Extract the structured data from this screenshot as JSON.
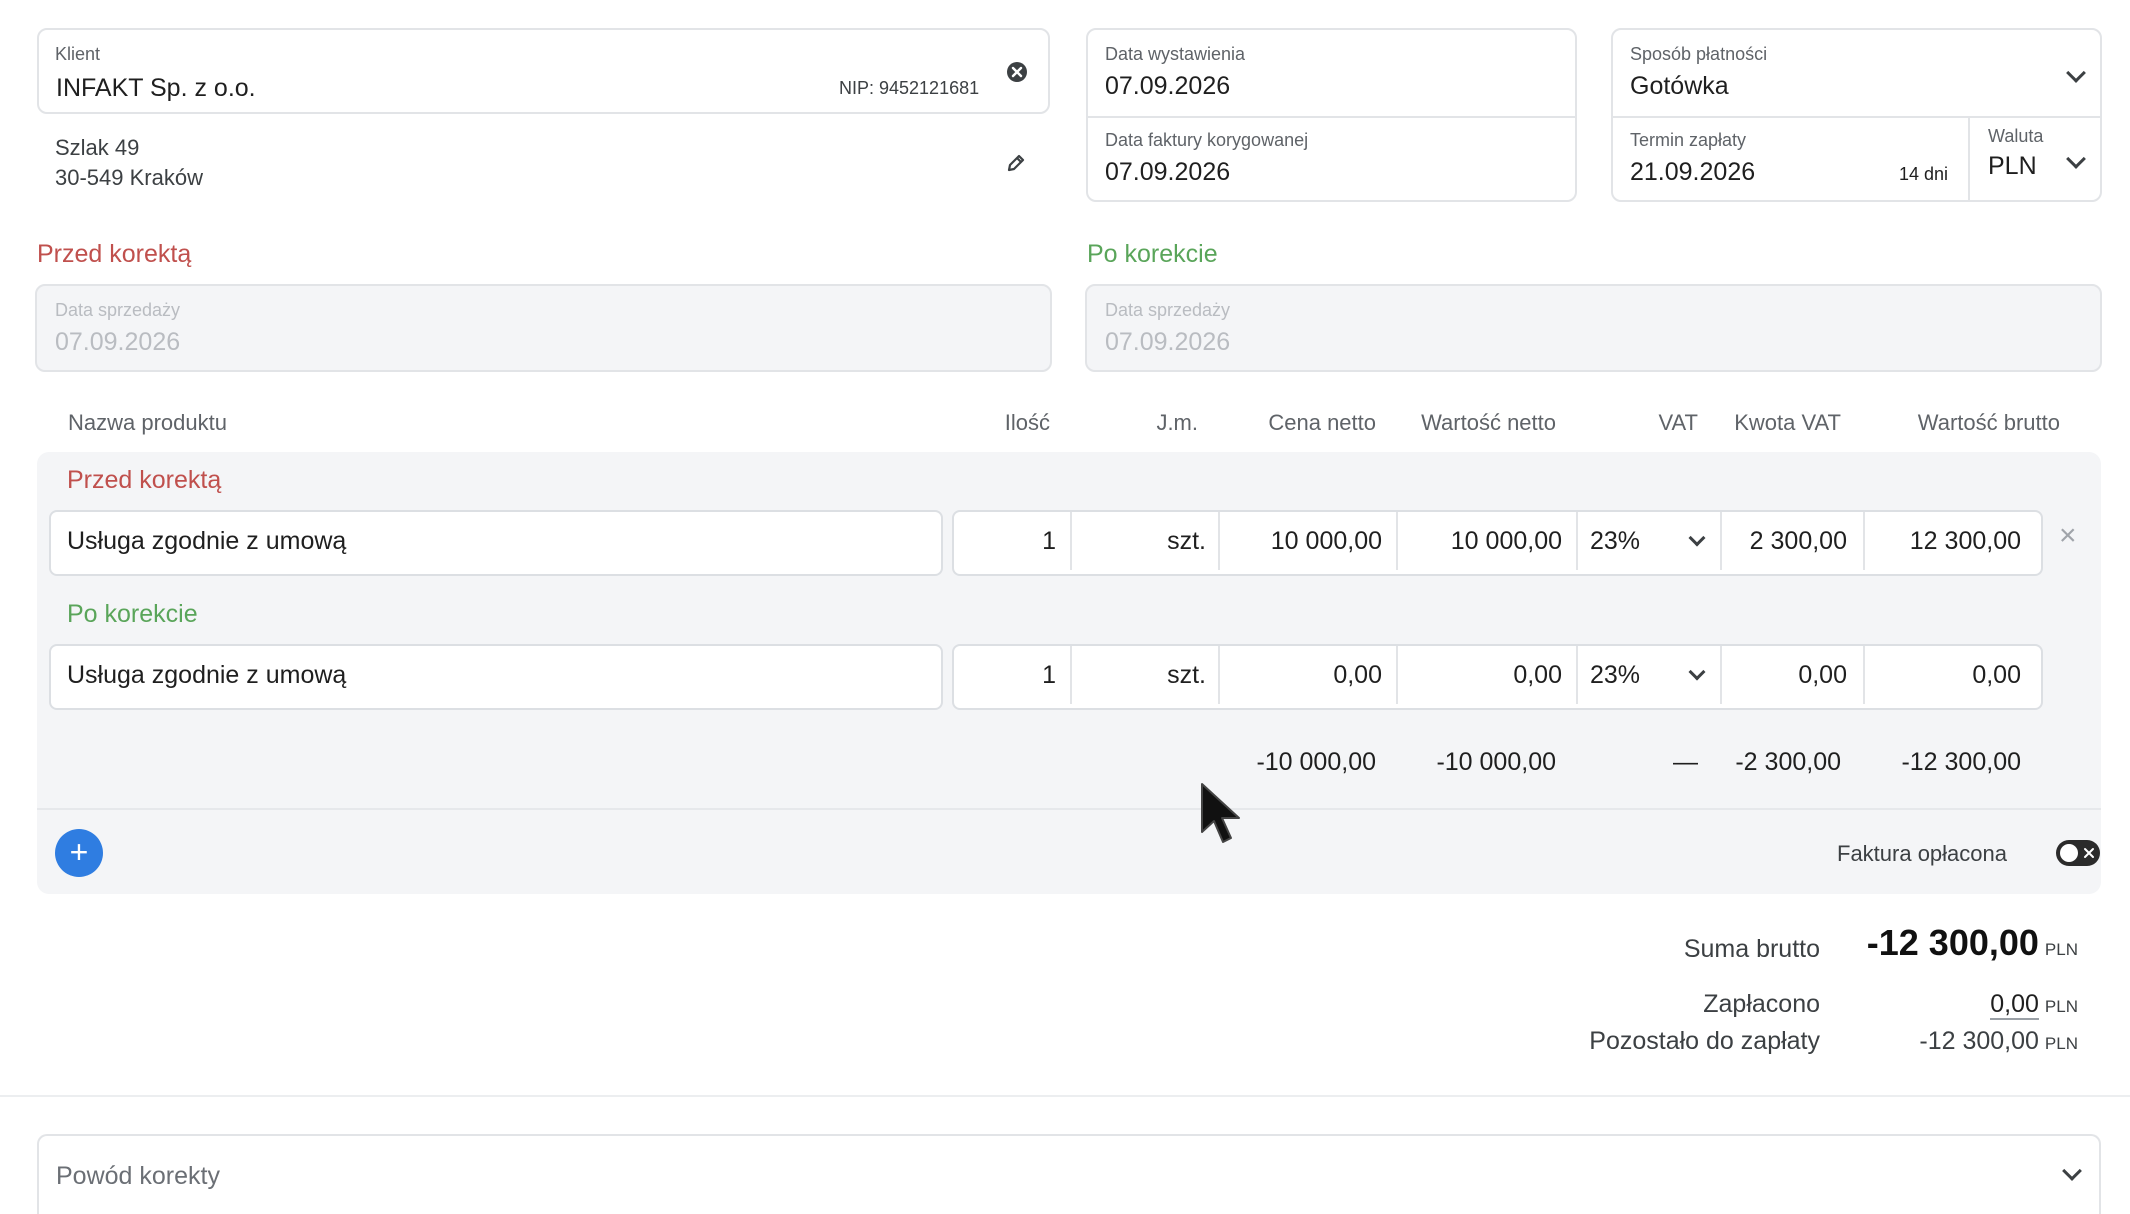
{
  "client": {
    "label": "Klient",
    "name": "INFAKT Sp. z o.o.",
    "nip": "NIP: 9452121681",
    "address_line1": "Szlak 49",
    "address_line2": "30-549 Kraków"
  },
  "dates": {
    "issue_label": "Data wystawienia",
    "issue_value": "07.09.2026",
    "corrected_label": "Data faktury korygowanej",
    "corrected_value": "07.09.2026"
  },
  "payment": {
    "method_label": "Sposób płatności",
    "method_value": "Gotówka",
    "due_label": "Termin zapłaty",
    "due_value": "21.09.2026",
    "due_days": "14 dni",
    "currency_label": "Waluta",
    "currency_value": "PLN"
  },
  "before": {
    "heading": "Przed korektą",
    "sale_date_label": "Data sprzedaży",
    "sale_date_value": "07.09.2026"
  },
  "after": {
    "heading": "Po korekcie",
    "sale_date_label": "Data sprzedaży",
    "sale_date_value": "07.09.2026"
  },
  "table": {
    "headers": {
      "name": "Nazwa produktu",
      "qty": "Ilość",
      "unit": "J.m.",
      "net_price": "Cena netto",
      "net_value": "Wartość netto",
      "vat": "VAT",
      "vat_amount": "Kwota VAT",
      "gross_value": "Wartość brutto"
    },
    "before_heading": "Przed korektą",
    "after_heading": "Po korekcie",
    "before_row": {
      "name": "Usługa zgodnie z umową",
      "qty": "1",
      "unit": "szt.",
      "net_price": "10 000,00",
      "net_value": "10 000,00",
      "vat": "23%",
      "vat_amount": "2 300,00",
      "gross_value": "12 300,00"
    },
    "after_row": {
      "name": "Usługa zgodnie z umową",
      "qty": "1",
      "unit": "szt.",
      "net_price": "0,00",
      "net_value": "0,00",
      "vat": "23%",
      "vat_amount": "0,00",
      "gross_value": "0,00"
    },
    "diff_row": {
      "net_price": "-10 000,00",
      "net_value": "-10 000,00",
      "vat": "—",
      "vat_amount": "-2 300,00",
      "gross_value": "-12 300,00"
    },
    "remove_symbol": "×",
    "add_symbol": "+"
  },
  "paid_toggle": {
    "label": "Faktura opłacona",
    "on": false
  },
  "summary": {
    "gross_label": "Suma brutto",
    "gross_value": "-12 300,00",
    "paid_label": "Zapłacono",
    "paid_value": "0,00",
    "remaining_label": "Pozostało do zapłaty",
    "remaining_value": "-12 300,00",
    "currency": "PLN"
  },
  "reason": {
    "placeholder": "Powód korekty"
  },
  "colors": {
    "before_red": "#c0504d",
    "after_green": "#5aa55a",
    "accent_blue": "#2f7de1"
  }
}
